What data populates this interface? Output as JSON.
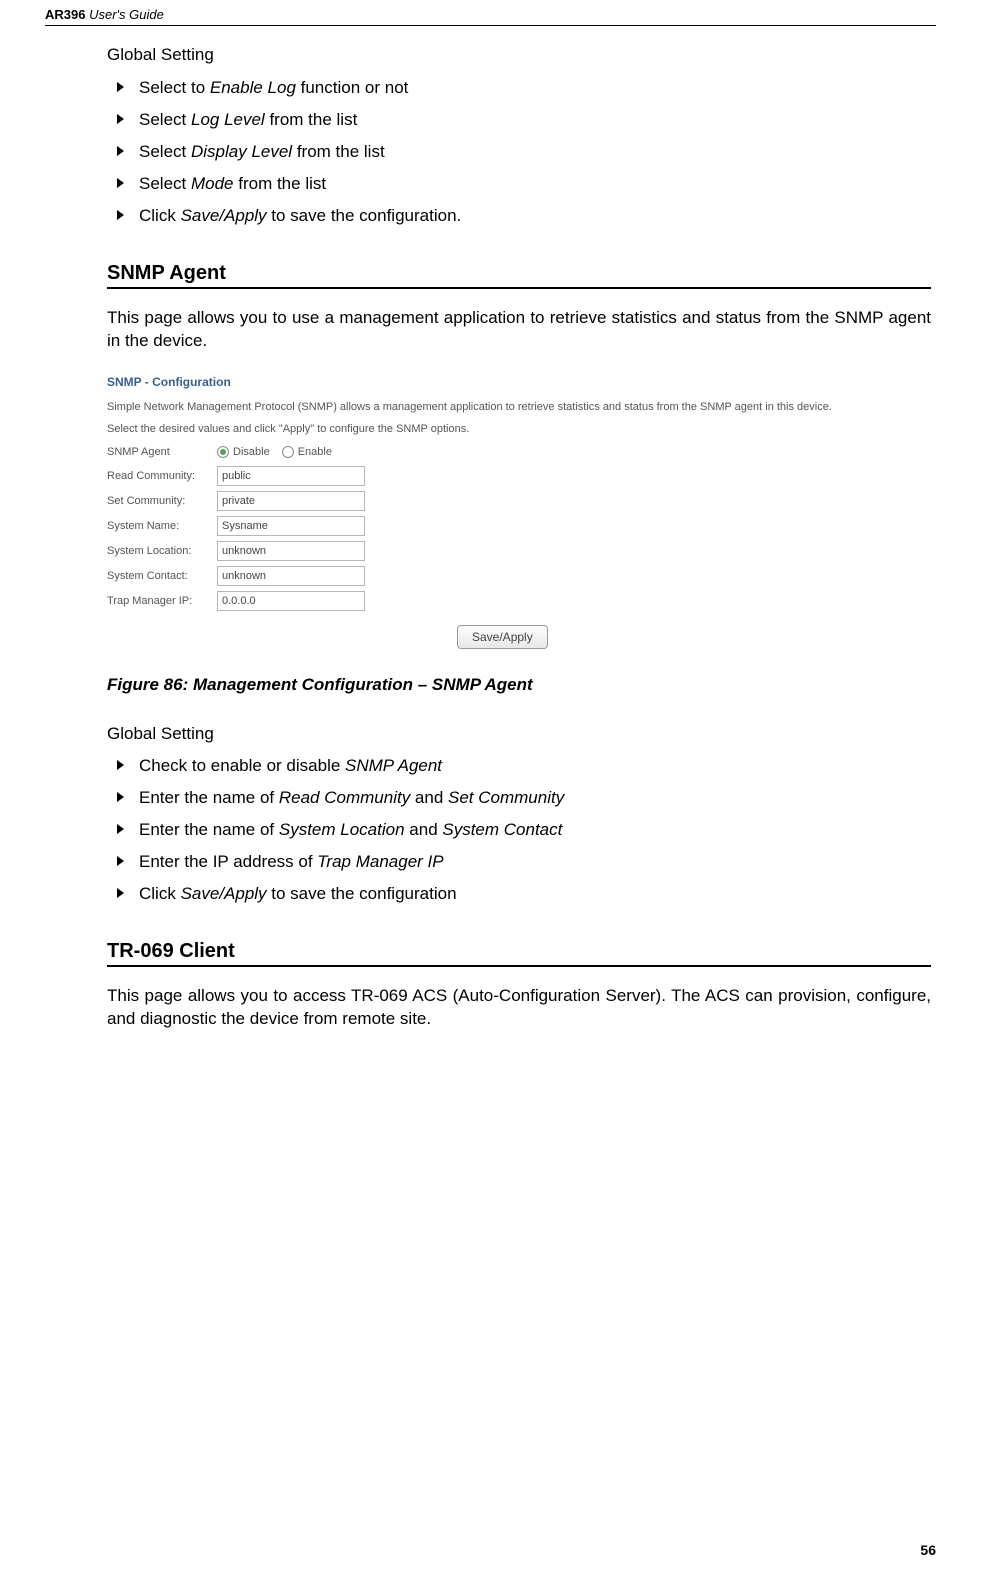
{
  "header": {
    "product": "AR396",
    "subtitle": "User's Guide"
  },
  "section1": {
    "global_setting_label": "Global Setting",
    "bullets": [
      {
        "pre": "Select to ",
        "it": "Enable Log",
        "post": " function or not"
      },
      {
        "pre": "Select ",
        "it": "Log Level",
        "post": " from the list"
      },
      {
        "pre": "Select ",
        "it": "Display Level",
        "post": " from the list"
      },
      {
        "pre": "Select ",
        "it": "Mode",
        "post": " from the list"
      },
      {
        "pre": "Click ",
        "it": "Save/Apply",
        "post": " to save the configuration."
      }
    ]
  },
  "snmp": {
    "heading": "SNMP Agent",
    "intro": "This page allows you to use a management application to retrieve statistics and status from the SNMP agent in the device.",
    "config_title": "SNMP - Configuration",
    "config_desc1": "Simple Network Management Protocol (SNMP) allows a management application to retrieve statistics and status from the SNMP agent in this device.",
    "config_desc2": "Select the desired values and click \"Apply\" to configure the SNMP options.",
    "agent_label": "SNMP Agent",
    "disable_label": "Disable",
    "enable_label": "Enable",
    "fields": {
      "read_community": {
        "label": "Read Community:",
        "value": "public"
      },
      "set_community": {
        "label": "Set Community:",
        "value": "private"
      },
      "system_name": {
        "label": "System Name:",
        "value": "Sysname"
      },
      "system_location": {
        "label": "System Location:",
        "value": "unknown"
      },
      "system_contact": {
        "label": "System Contact:",
        "value": "unknown"
      },
      "trap_manager_ip": {
        "label": "Trap Manager IP:",
        "value": "0.0.0.0"
      }
    },
    "save_apply": "Save/Apply",
    "figure_caption": "Figure 86: Management Configuration – SNMP Agent",
    "global_setting_label": "Global Setting",
    "bullets": [
      {
        "pre": "Check to enable or disable ",
        "it": "SNMP Agent",
        "post": ""
      },
      {
        "pre": "Enter the name of ",
        "it": "Read Community",
        "mid": " and ",
        "it2": "Set Community",
        "post": ""
      },
      {
        "pre": "Enter the name of ",
        "it": "System Location",
        "mid": " and ",
        "it2": "System Contact",
        "post": ""
      },
      {
        "pre": "Enter the IP address of ",
        "it": "Trap Manager IP",
        "post": ""
      },
      {
        "pre": "Click ",
        "it": "Save/Apply",
        "post": " to save the configuration"
      }
    ]
  },
  "tr069": {
    "heading": "TR-069 Client",
    "intro": "This page allows you to access TR-069 ACS (Auto-Configuration Server). The ACS can provision, configure, and diagnostic the device from remote site."
  },
  "page_number": "56"
}
